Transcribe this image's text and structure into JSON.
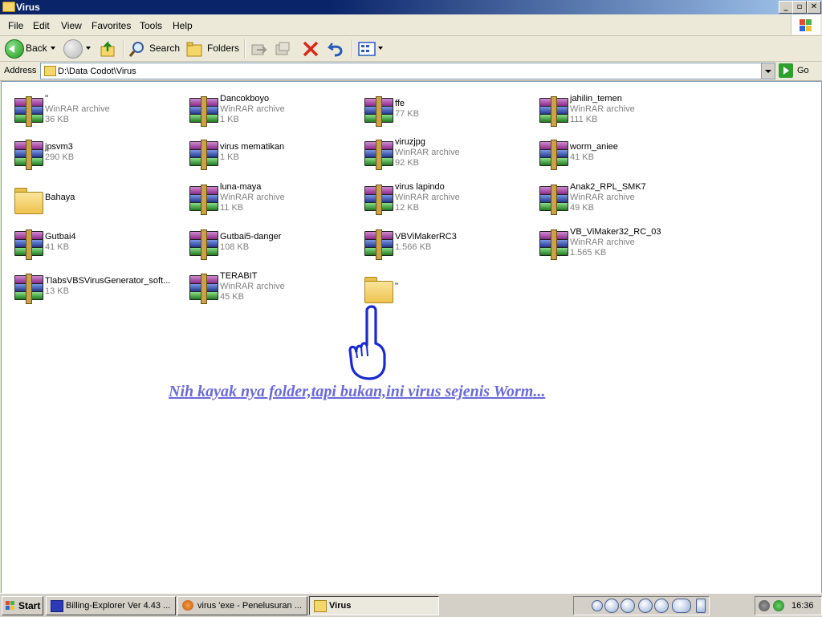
{
  "window": {
    "title": "Virus"
  },
  "menu": [
    "File",
    "Edit",
    "View",
    "Favorites",
    "Tools",
    "Help"
  ],
  "toolbar": {
    "back": "Back",
    "search": "Search",
    "folders": "Folders"
  },
  "address": {
    "label": "Address",
    "path": "D:\\Data Codot\\Virus",
    "go": "Go"
  },
  "files": [
    {
      "icon": "winrar-archive-icon",
      "name": "''",
      "type": "WinRAR archive",
      "size": "36 KB"
    },
    {
      "icon": "winrar-archive-icon",
      "name": "Dancokboyo",
      "type": "WinRAR archive",
      "size": "1 KB"
    },
    {
      "icon": "winrar-archive-icon",
      "name": "ffe",
      "type": "",
      "size": "77 KB"
    },
    {
      "icon": "winrar-archive-icon",
      "name": "jahilin_temen",
      "type": "WinRAR archive",
      "size": "111 KB"
    },
    {
      "icon": "winrar-archive-icon",
      "name": "jpsvm3",
      "type": "",
      "size": "290 KB"
    },
    {
      "icon": "winrar-archive-icon",
      "name": "virus mematikan",
      "type": "",
      "size": "1 KB"
    },
    {
      "icon": "winrar-archive-icon",
      "name": "viruzjpg",
      "type": "WinRAR archive",
      "size": "92 KB"
    },
    {
      "icon": "winrar-archive-icon",
      "name": "worm_aniee",
      "type": "",
      "size": "41 KB"
    },
    {
      "icon": "folder-icon",
      "name": "Bahaya",
      "type": "",
      "size": ""
    },
    {
      "icon": "winrar-archive-icon",
      "name": "luna-maya",
      "type": "WinRAR archive",
      "size": "11 KB"
    },
    {
      "icon": "winrar-archive-icon",
      "name": "virus lapindo",
      "type": "WinRAR archive",
      "size": "12 KB"
    },
    {
      "icon": "winrar-archive-icon",
      "name": "Anak2_RPL_SMK7",
      "type": "WinRAR archive",
      "size": "49 KB"
    },
    {
      "icon": "winrar-archive-icon",
      "name": "Gutbai4",
      "type": "",
      "size": "41 KB"
    },
    {
      "icon": "winrar-archive-icon",
      "name": "Gutbai5-danger",
      "type": "",
      "size": "108 KB"
    },
    {
      "icon": "winrar-archive-icon",
      "name": "VBViMakerRC3",
      "type": "",
      "size": "1.566 KB"
    },
    {
      "icon": "winrar-archive-icon",
      "name": "VB_ViMaker32_RC_03",
      "type": "WinRAR archive",
      "size": "1.565 KB"
    },
    {
      "icon": "winrar-archive-icon",
      "name": "TlabsVBSVirusGenerator_soft...",
      "type": "",
      "size": "13 KB"
    },
    {
      "icon": "winrar-archive-icon",
      "name": "TERABIT",
      "type": "WinRAR archive",
      "size": "45 KB"
    },
    {
      "icon": "folder-icon",
      "name": "''",
      "type": "",
      "size": ""
    }
  ],
  "annotation": {
    "caption": "Nih kayak nya folder,tapi bukan,ini virus sejenis Worm...",
    "icon": "pointing-hand-icon"
  },
  "taskbar": {
    "start": "Start",
    "tasks": [
      "Billing-Explorer Ver 4.43 ...",
      "virus 'exe - Penelusuran ...",
      "Virus"
    ],
    "clock": "16:36"
  },
  "colors": {
    "titlebar": "#0a246a",
    "caption": "#6a6ad8",
    "hand": "#1a2ad0"
  }
}
